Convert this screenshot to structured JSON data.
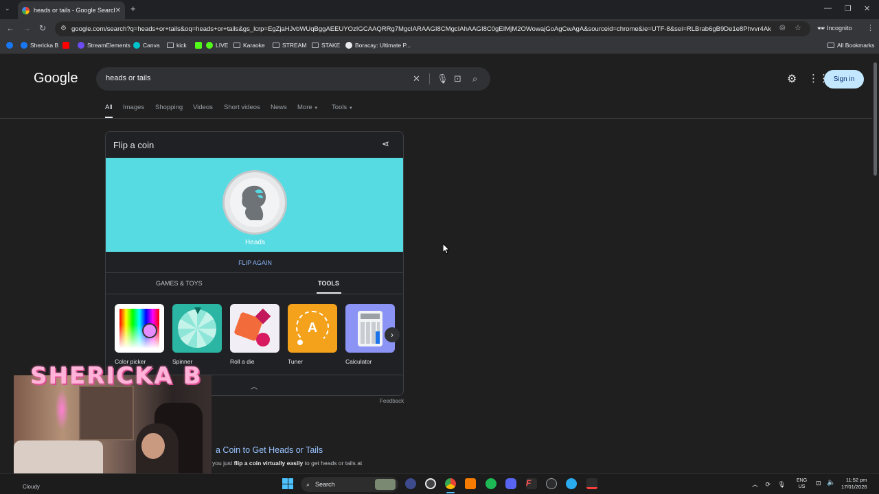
{
  "browser": {
    "tab_title": "heads or tails - Google Search",
    "url": "google.com/search?q=heads+or+tails&oq=heads+or+tails&gs_lcrp=EgZjaHJvbWUqBggAEEUYOzIGCAAQRRg7MgcIARAAGI8CMgcIAhAAGI8C0gEIMjM2OWowajGoAgCwAgA&sourceid=chrome&ie=UTF-8&sei=RLBrab6gB9De1e8Phvvr4Ak",
    "incognito_label": "Incognito",
    "all_bookmarks_label": "All Bookmarks",
    "bookmarks": [
      "Shericka B",
      "StreamElements",
      "Canva",
      "kick",
      "LIVE",
      "Karaoke",
      "STREAM",
      "STAKE",
      "Boracay: Ultimate P..."
    ]
  },
  "search": {
    "logo": "Google",
    "query": "heads or tails",
    "sign_in_label": "Sign in",
    "tabs": [
      "All",
      "Images",
      "Shopping",
      "Videos",
      "Short videos",
      "News",
      "More",
      "Tools"
    ]
  },
  "coin_card": {
    "title": "Flip a coin",
    "result_label": "Heads",
    "flip_again_label": "FLIP AGAIN",
    "tab_games": "GAMES & TOYS",
    "tab_tools": "TOOLS",
    "tools": [
      "Color picker",
      "Spinner",
      "Roll a die",
      "Tuner",
      "Calculator"
    ],
    "feedback_label": "Feedback",
    "coin_bg_color": "#56dbe3"
  },
  "result": {
    "title": "a Coin to Get Heads or Tails",
    "snippet_pre": "you just ",
    "snippet_bold1": "flip a coin virtually easily",
    "snippet_post": " to get heads or tails at"
  },
  "overlay": {
    "streamer_name": "SHERICKA B"
  },
  "taskbar": {
    "weather": "Cloudy",
    "search_label": "Search",
    "lang_line1": "ENG",
    "lang_line2": "US",
    "time": "11:52 pm",
    "date": "17/01/2026"
  }
}
